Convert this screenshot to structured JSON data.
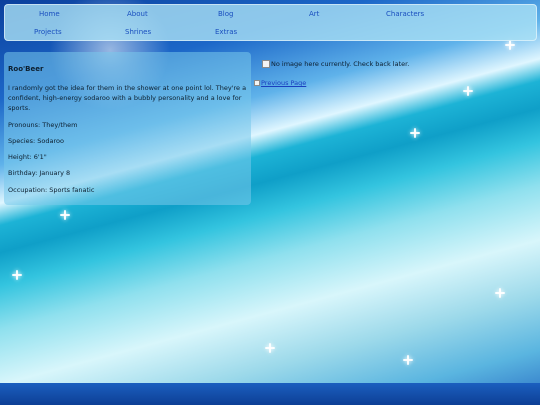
{
  "nav": {
    "items": [
      {
        "label": "Home"
      },
      {
        "label": "About"
      },
      {
        "label": "Blog"
      },
      {
        "label": "Art"
      },
      {
        "label": "Characters"
      },
      {
        "label": "Projects"
      },
      {
        "label": "Shrines"
      },
      {
        "label": "Extras"
      }
    ]
  },
  "profile": {
    "name": "Roo'Beer",
    "description": "I randomly got the idea for them in the shower at one point lol. They're a confident, high-energy sodaroo with a bubbly personality and a love for sports.",
    "pronouns": "Pronouns: They/them",
    "species": "Species: Sodaroo",
    "height": "Height: 6'1\"",
    "birthday": "Birthday: January 8",
    "occupation": "Occupation: Sports fanatic"
  },
  "image_area": {
    "no_image_text": "No image here currently. Check back later.",
    "previous_page_label": "Previous Page"
  },
  "colors": {
    "nav_bg": "#aae1f5",
    "link": "#1a4fbf",
    "card_bg": "#78c8eb",
    "text": "#0c1e2e"
  }
}
